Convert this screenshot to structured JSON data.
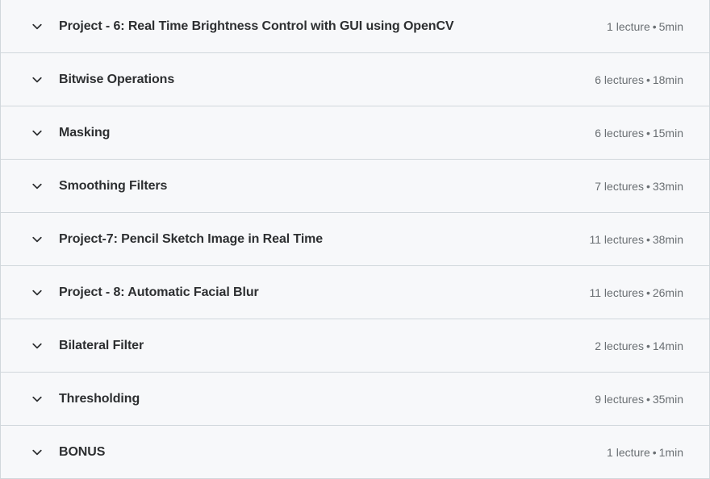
{
  "colors": {
    "row_background": "#f7f8fa",
    "border": "#d1d7dc",
    "title_text": "#2d2f31",
    "meta_text": "#6a6f73"
  },
  "curriculum": {
    "sections": [
      {
        "title": "Project - 6: Real Time Brightness Control with GUI using OpenCV",
        "lectures": "1 lecture",
        "separator": "•",
        "duration": "5min",
        "toggle_icon": "chevron-down-icon"
      },
      {
        "title": "Bitwise Operations",
        "lectures": "6 lectures",
        "separator": "•",
        "duration": "18min",
        "toggle_icon": "chevron-down-icon"
      },
      {
        "title": "Masking",
        "lectures": "6 lectures",
        "separator": "•",
        "duration": "15min",
        "toggle_icon": "chevron-down-icon"
      },
      {
        "title": "Smoothing Filters",
        "lectures": "7 lectures",
        "separator": "•",
        "duration": "33min",
        "toggle_icon": "chevron-down-icon"
      },
      {
        "title": "Project-7: Pencil Sketch Image in Real Time",
        "lectures": "11 lectures",
        "separator": "•",
        "duration": "38min",
        "toggle_icon": "chevron-down-icon"
      },
      {
        "title": "Project - 8: Automatic Facial Blur",
        "lectures": "11 lectures",
        "separator": "•",
        "duration": "26min",
        "toggle_icon": "chevron-down-icon"
      },
      {
        "title": "Bilateral Filter",
        "lectures": "2 lectures",
        "separator": "•",
        "duration": "14min",
        "toggle_icon": "chevron-down-icon"
      },
      {
        "title": "Thresholding",
        "lectures": "9 lectures",
        "separator": "•",
        "duration": "35min",
        "toggle_icon": "chevron-down-icon"
      },
      {
        "title": "BONUS",
        "lectures": "1 lecture",
        "separator": "•",
        "duration": "1min",
        "toggle_icon": "chevron-down-icon"
      }
    ]
  }
}
